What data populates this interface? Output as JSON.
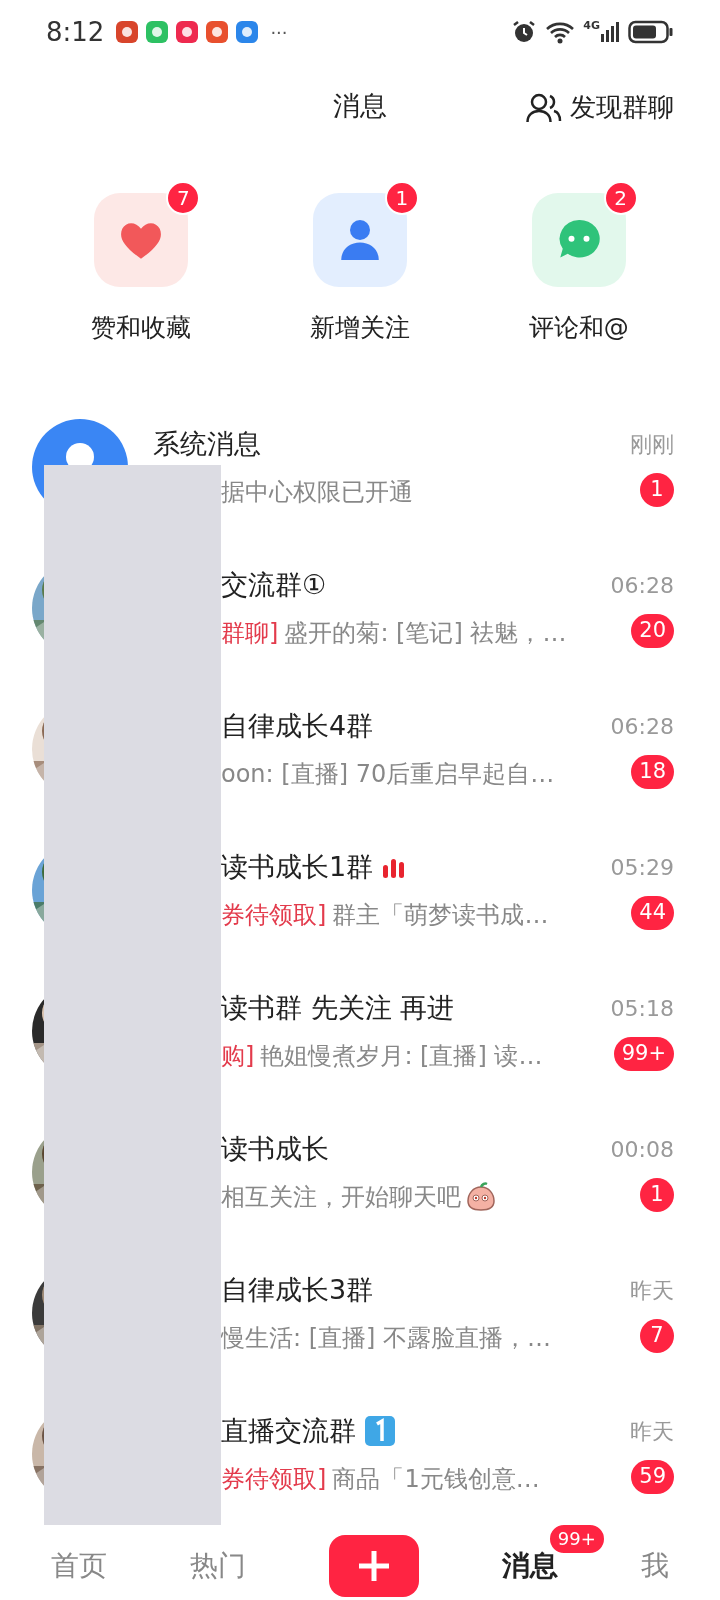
{
  "status_bar": {
    "time": "8:12",
    "more": "···",
    "network": "4G"
  },
  "header": {
    "title": "消息",
    "action": "发现群聊"
  },
  "quick_actions": [
    {
      "label": "赞和收藏",
      "count": "7"
    },
    {
      "label": "新增关注",
      "count": "1"
    },
    {
      "label": "评论和@",
      "count": "2"
    }
  ],
  "conversations": [
    {
      "kind": "system",
      "title": "系统消息",
      "preview": "据中心权限已开通",
      "time": "刚刚",
      "unread": "1"
    },
    {
      "kind": "group",
      "title": "交流群①",
      "tag": "群聊]",
      "preview": "盛开的菊: [笔记] 祛魅，…",
      "time": "06:28",
      "unread": "20"
    },
    {
      "kind": "group",
      "title": "自律成长4群",
      "preview": "oon: [直播] 70后重启早起自…",
      "time": "06:28",
      "unread": "18"
    },
    {
      "kind": "group",
      "title": "读书成长1群",
      "live": true,
      "tag": "券待领取]",
      "preview": "群主「萌梦读书成…",
      "time": "05:29",
      "unread": "44"
    },
    {
      "kind": "group",
      "title": "读书群 先关注 再进",
      "tag": "购]",
      "preview": "艳姐慢煮岁月: [直播] 读…",
      "time": "05:18",
      "unread": "99+"
    },
    {
      "kind": "user",
      "title": "读书成长",
      "preview": "相互关注，开始聊天吧",
      "sticker": true,
      "time": "00:08",
      "unread": "1"
    },
    {
      "kind": "group",
      "title": "自律成长3群",
      "preview": "慢生活: [直播] 不露脸直播，…",
      "time": "昨天",
      "unread": "7"
    },
    {
      "kind": "group",
      "title": "直播交流群",
      "number_emoji": true,
      "tag": "券待领取]",
      "preview": "商品「1元钱创意…",
      "time": "昨天",
      "unread": "59"
    }
  ],
  "bottom_nav": [
    {
      "kind": "tab",
      "label": "首页",
      "selected": false
    },
    {
      "kind": "tab",
      "label": "热门",
      "selected": false
    },
    {
      "kind": "add"
    },
    {
      "kind": "tab",
      "label": "消息",
      "selected": true,
      "badge": "99+"
    },
    {
      "kind": "tab",
      "label": "我",
      "selected": false
    }
  ]
}
